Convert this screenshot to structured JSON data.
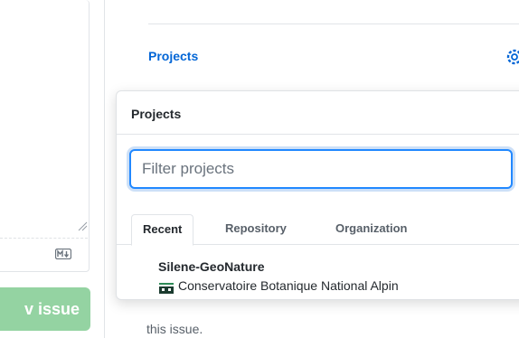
{
  "left_pane": {
    "submit_label": "v issue",
    "markdown_icon": "markdown-icon",
    "resize_icon": "resize-grip-icon"
  },
  "sidebar": {
    "projects_heading": "Projects",
    "settings_icon": "gear-icon",
    "below_text": "this issue."
  },
  "popover": {
    "title": "Projects",
    "filter": {
      "placeholder": "Filter projects",
      "value": ""
    },
    "tabs": [
      {
        "label": "Recent",
        "selected": true
      },
      {
        "label": "Repository",
        "selected": false
      },
      {
        "label": "Organization",
        "selected": false
      }
    ],
    "items": [
      {
        "name": "Silene-GeoNature",
        "owner": "Conservatoire Botanique National Alpin",
        "owner_icon": "org-avatar-icon"
      }
    ]
  },
  "colors": {
    "link": "#0366d6",
    "focus": "#2188ff",
    "submit_disabled": "#94d3a2",
    "border": "#e1e4e8"
  }
}
